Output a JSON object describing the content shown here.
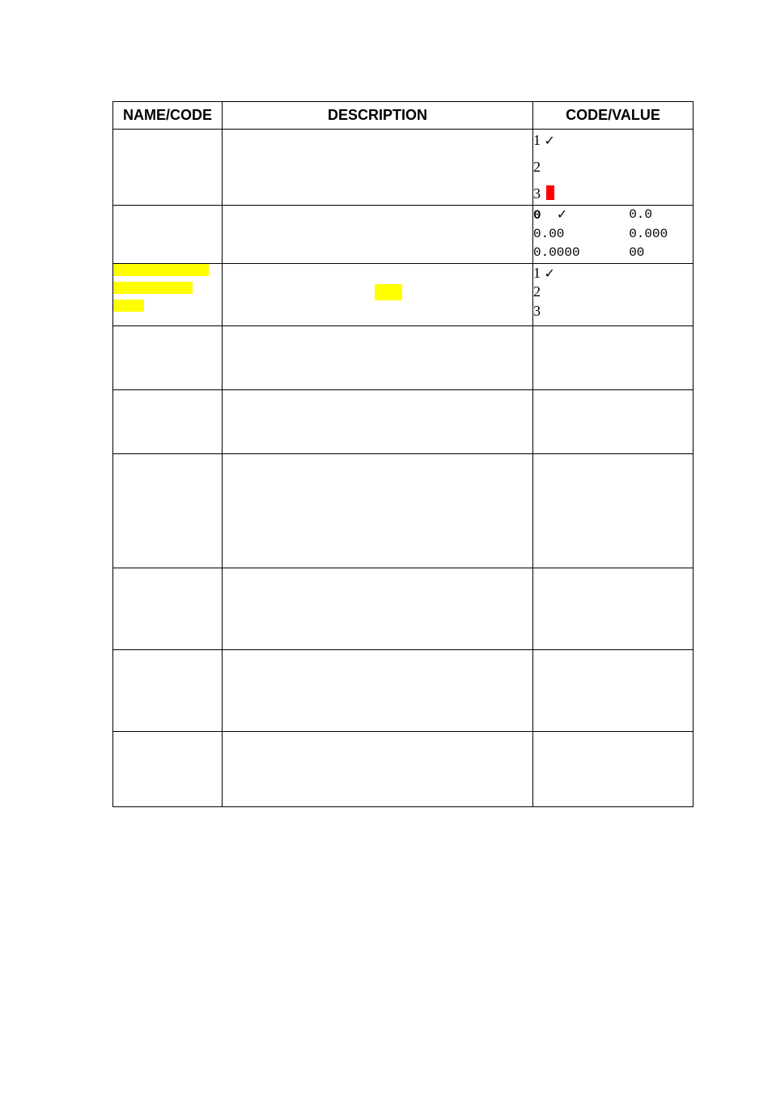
{
  "headers": {
    "name": "NAME/CODE",
    "desc": "DESCRIPTION",
    "value": "CODE/VALUE"
  },
  "row1": {
    "lines": {
      "l1_num": "1",
      "l1_check": "✓",
      "l2_num": "2",
      "l3_num": "3"
    }
  },
  "row2": {
    "a1": "0",
    "a1check": "✓",
    "b1": "0.0",
    "a2": "0.00",
    "b2": "0.000",
    "a3": "0.0000",
    "b3": "00"
  },
  "row3": {
    "l1_num": "1",
    "l1_check": "✓",
    "l2_num": "2",
    "l3_num": "3"
  }
}
